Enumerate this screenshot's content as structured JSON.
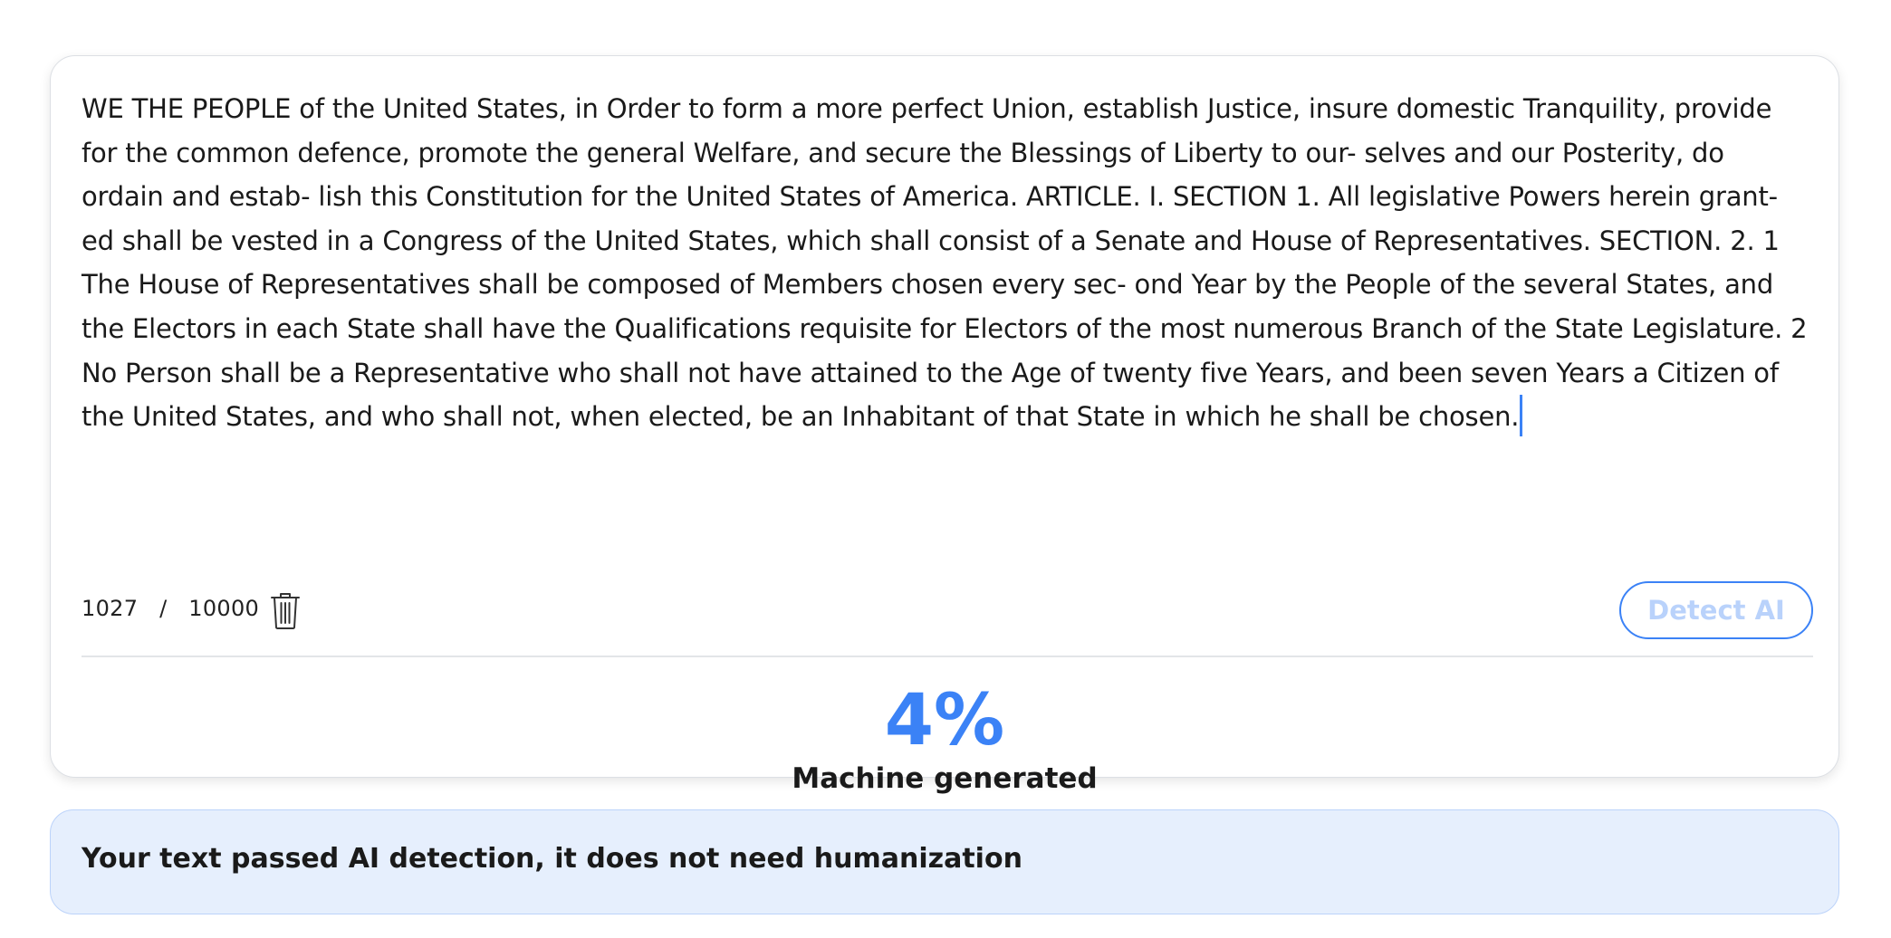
{
  "editor": {
    "text": "WE THE PEOPLE of the United States, in Order to form a more perfect Union, establish Justice, insure domestic Tranquility, provide for the common defence, promote the general Welfare, and secure the Blessings of Liberty to our- selves and our Posterity, do ordain and estab- lish this Constitution for the United States of America. ARTICLE. I. SECTION 1. All legislative Powers herein grant- ed shall be vested in a Congress of the United States, which shall consist of a Senate and House of Representatives. SECTION. 2. 1 The House of Representatives shall be composed of Members chosen every sec- ond Year by the People of the several States, and the Electors in each State shall have the Qualifications requisite for Electors of the most numerous Branch of the State Legislature. 2 No Person shall be a Representative who shall not have attained to the Age of twenty five Years, and been seven Years a Citizen of the United States, and who shall not, when elected, be an Inhabitant of that State in which he shall be chosen.",
    "char_count": "1027",
    "separator": "/",
    "char_limit": "10000",
    "detect_button_label": "Detect AI",
    "delete_icon": "trash-icon"
  },
  "result": {
    "percentage": "4%",
    "label": "Machine generated"
  },
  "banner": {
    "message": "Your text passed AI detection, it does not need humanization"
  },
  "colors": {
    "accent": "#3b82f6",
    "button_text_disabled": "#b9d2fb",
    "banner_background": "#e6effd",
    "banner_border": "#bcd3fa",
    "text": "#1a1a1a"
  }
}
